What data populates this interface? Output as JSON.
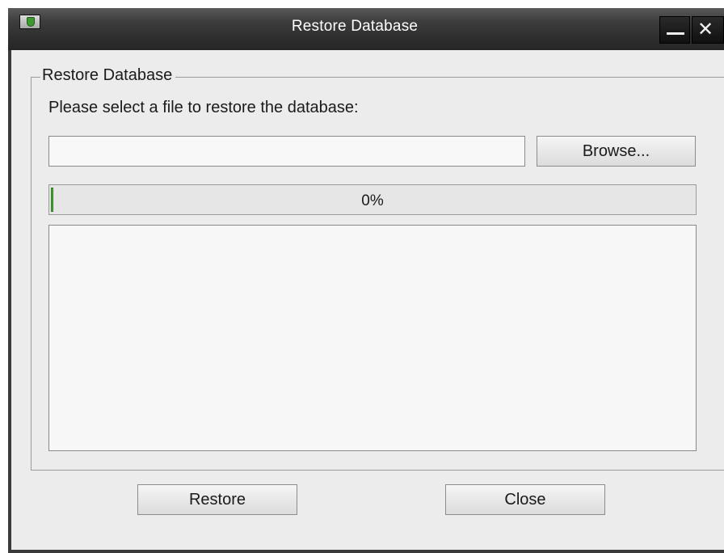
{
  "window": {
    "title": "Restore Database",
    "minimize_icon": "minimize-icon",
    "close_icon": "close-icon",
    "app_icon": "shield-icon",
    "close_glyph": "✕"
  },
  "group": {
    "legend": "Restore Database",
    "instruction": "Please select a file to restore the database:"
  },
  "file_input": {
    "value": "",
    "placeholder": ""
  },
  "buttons": {
    "browse": "Browse...",
    "restore": "Restore",
    "close": "Close"
  },
  "progress": {
    "value": 0,
    "label": "0%"
  },
  "log": {
    "text": ""
  },
  "colors": {
    "titlebar": "#2e2e2e",
    "window_bg": "#ececec",
    "progress_fill": "#4caf3a"
  }
}
